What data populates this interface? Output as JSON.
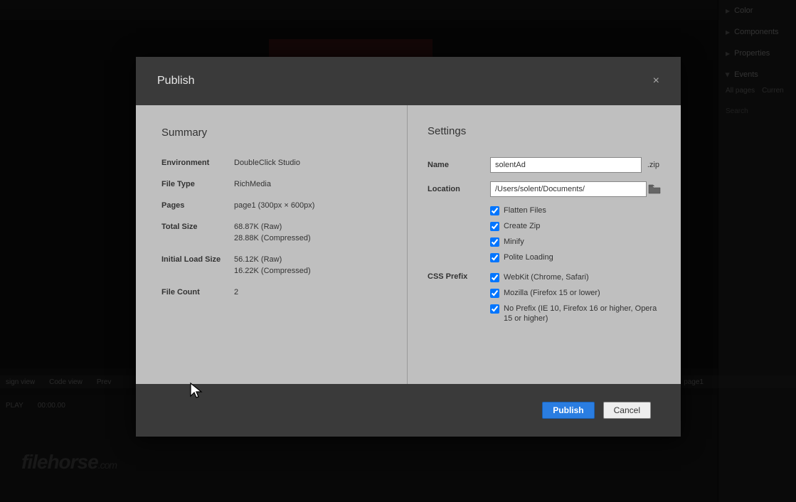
{
  "dialog": {
    "title": "Publish",
    "close": "×",
    "summary_heading": "Summary",
    "settings_heading": "Settings",
    "summary": {
      "environment_label": "Environment",
      "environment_value": "DoubleClick Studio",
      "filetype_label": "File Type",
      "filetype_value": "RichMedia",
      "pages_label": "Pages",
      "pages_value": "page1 (300px × 600px)",
      "totalsize_label": "Total Size",
      "totalsize_raw": "68.87K (Raw)",
      "totalsize_compressed": "28.88K (Compressed)",
      "initial_label": "Initial Load Size",
      "initial_raw": "56.12K (Raw)",
      "initial_compressed": "16.22K (Compressed)",
      "filecount_label": "File Count",
      "filecount_value": "2"
    },
    "settings": {
      "name_label": "Name",
      "name_value": "solentAd",
      "name_ext": ".zip",
      "location_label": "Location",
      "location_value": "/Users/solent/Documents/",
      "flatten": "Flatten Files",
      "createzip": "Create Zip",
      "minify": "Minify",
      "polite": "Polite Loading",
      "css_prefix_label": "CSS Prefix",
      "webkit": "WebKit (Chrome, Safari)",
      "mozilla": "Mozilla (Firefox 15 or lower)",
      "noprefix": "No Prefix (IE 10, Firefox 16 or higher, Opera 15 or higher)"
    },
    "buttons": {
      "publish": "Publish",
      "cancel": "Cancel"
    }
  },
  "right_panel": {
    "color": "Color",
    "components": "Components",
    "properties": "Properties",
    "events": "Events",
    "all_pages": "All pages",
    "curren": "Curren",
    "search": "Search"
  },
  "bottom": {
    "design": "sign view",
    "code": "Code view",
    "prev": "Prev",
    "page1": "page1"
  },
  "timeline": {
    "play": "PLAY",
    "time": "00:00.00"
  },
  "watermark": {
    "main": "filehorse",
    "ext": ".com"
  }
}
